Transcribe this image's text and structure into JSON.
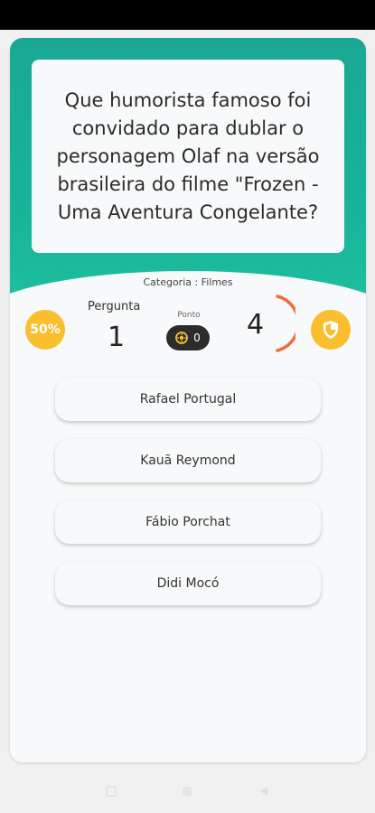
{
  "question": "Que humorista famoso foi convidado para dublar o personagem Olaf na versão brasileira do filme \"Frozen - Uma Aventura Congelante?",
  "category": "Categoria : Filmes",
  "lifelines": {
    "fifty_label": "50%"
  },
  "stats": {
    "pergunta_label": "Pergunta",
    "pergunta_value": "1",
    "ponto_label": "Ponto",
    "ponto_value": "0",
    "timer_value": "4"
  },
  "answers": [
    {
      "label": "Rafael Portugal"
    },
    {
      "label": "Kauã Reymond"
    },
    {
      "label": "Fábio Porchat"
    },
    {
      "label": "Didi Mocó"
    }
  ],
  "colors": {
    "accent": "#1aa894",
    "gold": "#f9bf2f",
    "timer": "#f26b3a"
  }
}
